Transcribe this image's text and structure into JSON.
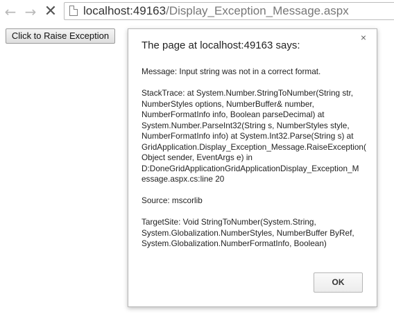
{
  "browser": {
    "url_host": "localhost:49163",
    "url_path": "/Display_Exception_Message.aspx"
  },
  "page": {
    "raise_button_label": "Click to Raise Exception"
  },
  "dialog": {
    "title": "The page at localhost:49163 says:",
    "close_glyph": "×",
    "message_line1": "Message: Input string was not in a correct format.",
    "stack_line1": "StackTrace:    at System.Number.StringToNumber(String str,",
    "stack_line2": "NumberStyles options, NumberBuffer& number,",
    "stack_line3": "NumberFormatInfo info, Boolean parseDecimal)    at",
    "stack_line4": "System.Number.ParseInt32(String s, NumberStyles style,",
    "stack_line5": "NumberFormatInfo info)    at System.Int32.Parse(String s)    at",
    "stack_line6": "GridApplication.Display_Exception_Message.RaiseException(",
    "stack_line7": "Object sender, EventArgs e) in",
    "stack_line8": "D:DoneGridApplicationGridApplicationDisplay_Exception_M",
    "stack_line9": "essage.aspx.cs:line 20",
    "source_line1": "Source: mscorlib",
    "target_line1": "TargetSite: Void StringToNumber(System.String,",
    "target_line2": "System.Globalization.NumberStyles, NumberBuffer ByRef,",
    "target_line3": "System.Globalization.NumberFormatInfo, Boolean)",
    "ok_label": "OK"
  }
}
